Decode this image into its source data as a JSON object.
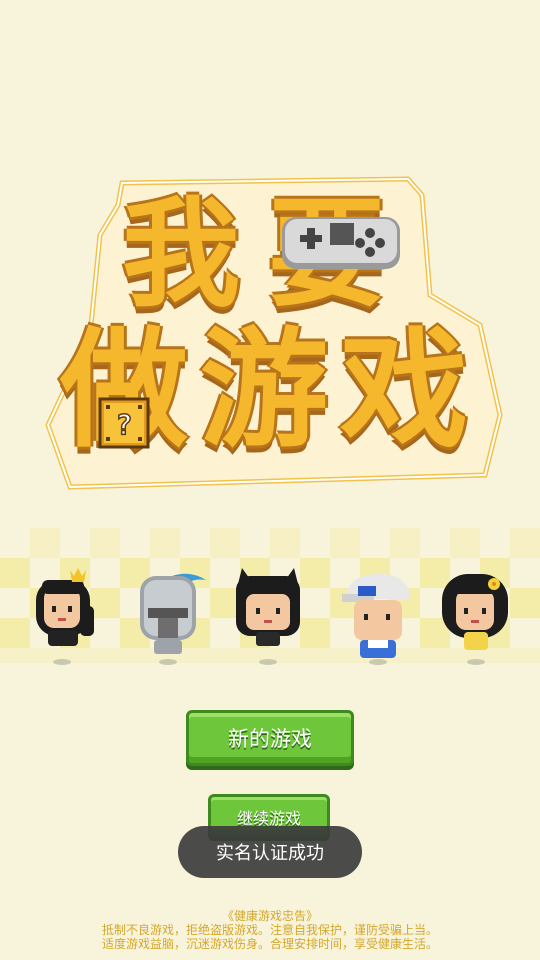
{
  "logo": {
    "line1": [
      "我",
      "要"
    ],
    "line2": [
      "做",
      "游",
      "戏"
    ]
  },
  "characters": [
    {
      "id": "princess",
      "label": ""
    },
    {
      "id": "knight",
      "label": ""
    },
    {
      "id": "cat-girl",
      "label": ""
    },
    {
      "id": "cap-boy",
      "label": ""
    },
    {
      "id": "flower-girl",
      "label": ""
    }
  ],
  "menu": {
    "new_game": "新的游戏",
    "continue_game": "继续游戏"
  },
  "toast": {
    "message": "实名认证成功"
  },
  "health_notice": {
    "title": "《健康游戏忠告》",
    "line1": "抵制不良游戏，拒绝盗版游戏。注意自我保护，谨防受骗上当。",
    "line2": "适度游戏益脑，沉迷游戏伤身。合理安排时间，享受健康生活。"
  },
  "colors": {
    "background": "#f8f4dc",
    "logo_yellow": "#f5b82c",
    "button_green": "#6ec63a",
    "notice_text": "#d4a72c"
  }
}
